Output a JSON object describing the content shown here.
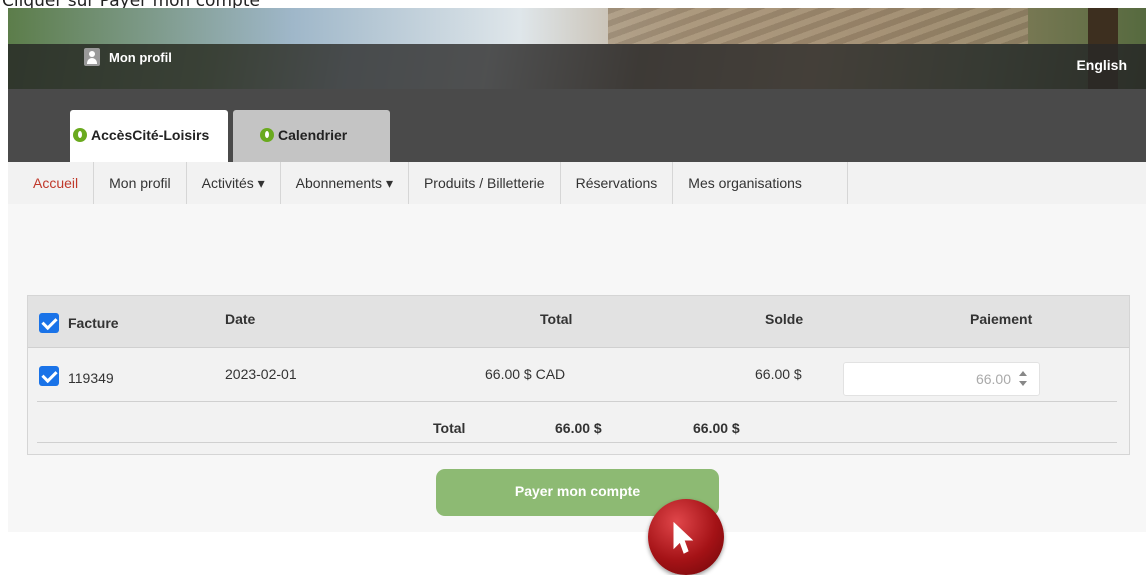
{
  "caption": "Cliquer sur Payer mon compte",
  "header": {
    "profile_label": "Mon profil",
    "language_label": "English"
  },
  "tabs": [
    {
      "label": "AccèsCité-Loisirs",
      "active": true
    },
    {
      "label": "Calendrier",
      "active": false
    }
  ],
  "nav": {
    "items": [
      {
        "label": "Accueil",
        "active": true
      },
      {
        "label": "Mon profil"
      },
      {
        "label": "Activités ▾"
      },
      {
        "label": "Abonnements ▾"
      },
      {
        "label": "Produits / Billetterie"
      },
      {
        "label": "Réservations"
      },
      {
        "label": "Mes organisations"
      }
    ]
  },
  "table": {
    "headers": {
      "facture": "Facture",
      "date": "Date",
      "total": "Total",
      "solde": "Solde",
      "paiement": "Paiement"
    },
    "rows": [
      {
        "checked": true,
        "facture": "119349",
        "date": "2023-02-01",
        "total": "66.00 $ CAD",
        "solde": "66.00 $",
        "paiement": "66.00"
      }
    ],
    "footer": {
      "label": "Total",
      "total": "66.00 $",
      "solde": "66.00 $"
    }
  },
  "actions": {
    "pay_label": "Payer mon compte"
  },
  "colors": {
    "accent_checkbox": "#1a73e8",
    "pay_button": "#8dba73",
    "nav_active": "#c0392b",
    "tab_icon": "#6aaa1e"
  }
}
